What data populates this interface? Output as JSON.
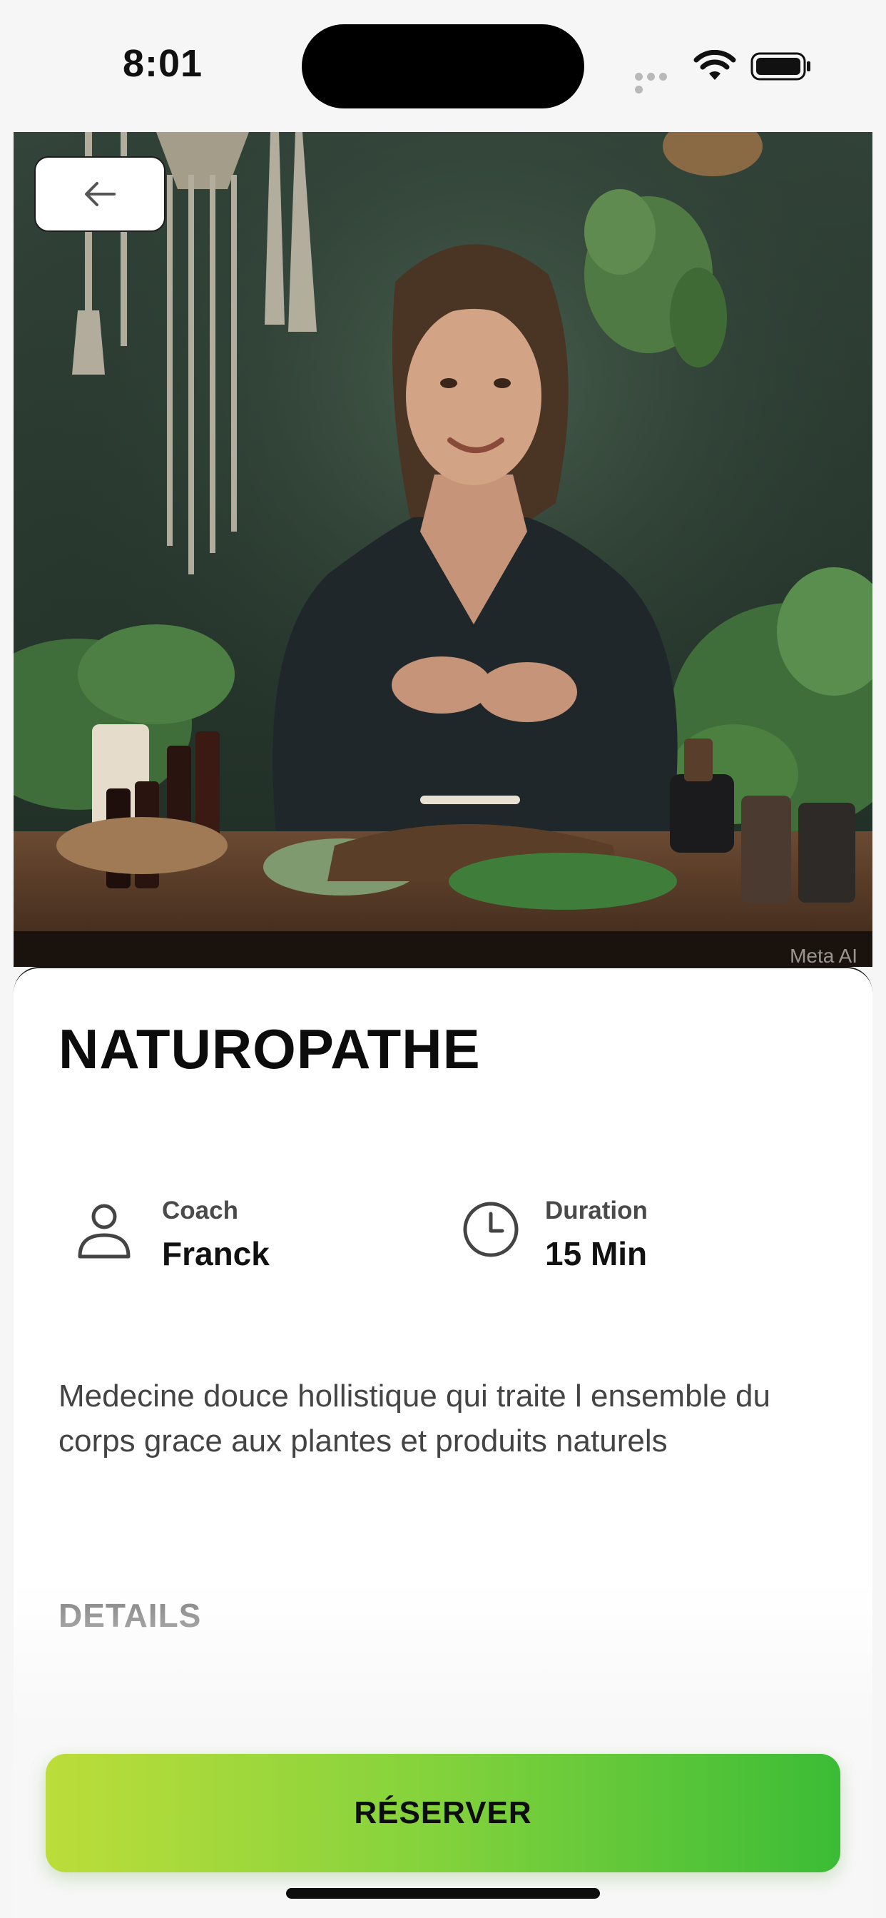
{
  "status_bar": {
    "time": "8:01"
  },
  "hero": {
    "image_description": "woman-preparing-herbal-remedies",
    "watermark": "Meta AI"
  },
  "nav": {
    "back_icon": "arrow-left-icon"
  },
  "service": {
    "title": "NATUROPATHE",
    "coach_label": "Coach",
    "coach_value": "Franck",
    "coach_icon": "user-icon",
    "duration_label": "Duration",
    "duration_value": "15 Min",
    "duration_icon": "clock-icon",
    "description": "Medecine douce hollistique qui traite l ensemble du corps grace aux plantes et produits naturels",
    "details_heading": "DETAILS"
  },
  "cta": {
    "reserve_label": "RÉSERVER"
  },
  "colors": {
    "cta_gradient_start": "#bcdd3a",
    "cta_gradient_end": "#3bbc36",
    "title_text": "#0c0c0c"
  }
}
